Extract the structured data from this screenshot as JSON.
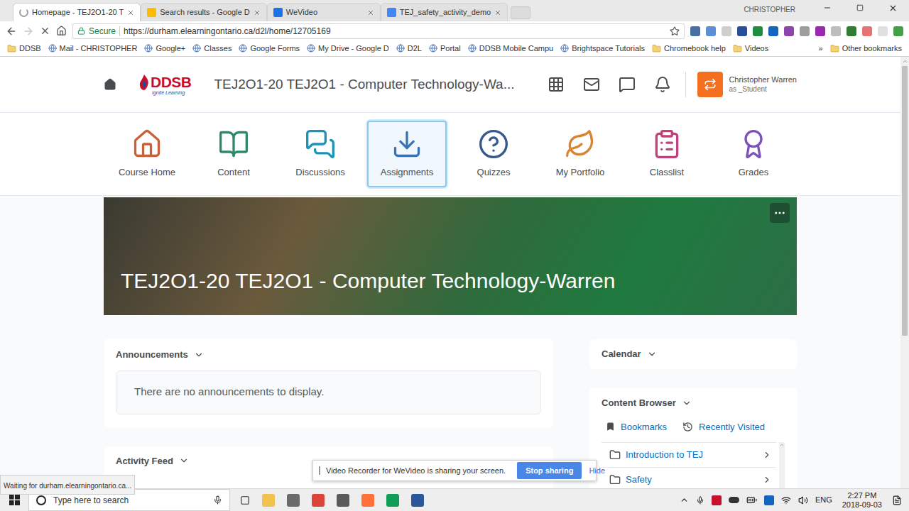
{
  "browser": {
    "tabs": [
      {
        "label": "Homepage - TEJ2O1-20 T",
        "selected": true,
        "loading": true
      },
      {
        "label": "Search results - Google D",
        "selected": false,
        "loading": false
      },
      {
        "label": "WeVideo",
        "selected": false,
        "loading": false
      },
      {
        "label": "TEJ_safety_activity_demo",
        "selected": false,
        "loading": false
      }
    ],
    "profile": "CHRISTOPHER",
    "forward_disabled": true,
    "secure_label": "Secure",
    "url": "https://durham.elearningontario.ca/d2l/home/12705169",
    "bookmarks": [
      {
        "label": "DDSB",
        "kind": "folder"
      },
      {
        "label": "Mail - CHRISTOPHER",
        "kind": "page"
      },
      {
        "label": "Google+",
        "kind": "page"
      },
      {
        "label": "Classes",
        "kind": "page"
      },
      {
        "label": "Google Forms",
        "kind": "page"
      },
      {
        "label": "My Drive - Google D",
        "kind": "page"
      },
      {
        "label": "D2L",
        "kind": "page"
      },
      {
        "label": "Portal",
        "kind": "page"
      },
      {
        "label": "DDSB Mobile Campu",
        "kind": "page"
      },
      {
        "label": "Brightspace Tutorials",
        "kind": "page"
      },
      {
        "label": "Chromebook help",
        "kind": "folder"
      },
      {
        "label": "Videos",
        "kind": "folder"
      }
    ],
    "more": "»",
    "other_bookmarks": "Other bookmarks"
  },
  "page": {
    "logo": {
      "text": "DDSB",
      "tagline": "Ignite Learning"
    },
    "course_title": "TEJ2O1-20 TEJ2O1 - Computer Technology-Wa...",
    "user_name": "Christopher Warren",
    "user_role": "as _Student",
    "nav": [
      {
        "label": "Course Home",
        "selected": false
      },
      {
        "label": "Content",
        "selected": false
      },
      {
        "label": "Discussions",
        "selected": false
      },
      {
        "label": "Assignments",
        "selected": true
      },
      {
        "label": "Quizzes",
        "selected": false
      },
      {
        "label": "My Portfolio",
        "selected": false
      },
      {
        "label": "Classlist",
        "selected": false
      },
      {
        "label": "Grades",
        "selected": false
      }
    ],
    "banner_title": "TEJ2O1-20 TEJ2O1 - Computer Technology-Warren",
    "announcements": {
      "title": "Announcements",
      "empty": "There are no announcements to display."
    },
    "activity_feed": {
      "title": "Activity Feed"
    },
    "calendar": {
      "title": "Calendar"
    },
    "content_browser": {
      "title": "Content Browser",
      "links": [
        "Bookmarks",
        "Recently Visited"
      ],
      "items": [
        "Introduction to TEJ",
        "Safety"
      ]
    }
  },
  "sharing_bar": {
    "message": "Video Recorder for WeVideo is sharing your screen.",
    "stop": "Stop sharing",
    "hide": "Hide"
  },
  "status": "Waiting for durham.elearningontario.ca...",
  "taskbar": {
    "search_placeholder": "Type here to search",
    "language": "ENG",
    "time": "2:27 PM",
    "date": "2018-09-03"
  }
}
